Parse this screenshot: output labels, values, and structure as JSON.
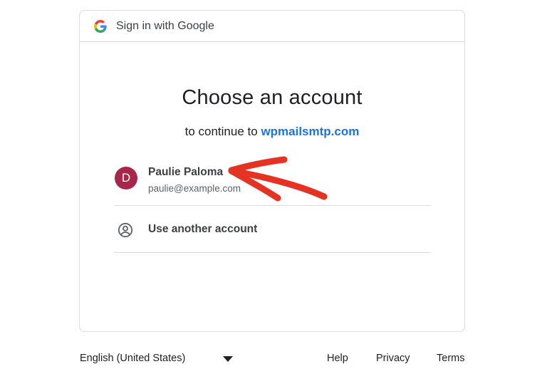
{
  "header": {
    "title": "Sign in with Google",
    "logo_icon": "google-g-logo"
  },
  "main": {
    "title": "Choose an account",
    "subtitle_prefix": "to continue to",
    "site": "wpmailsmtp.com",
    "accounts": [
      {
        "initial": "D",
        "name": "Paulie Paloma",
        "email": "paulie@example.com",
        "avatar_color": "#a8264a"
      }
    ],
    "other_account": {
      "label": "Use another account",
      "icon": "person-circle-icon"
    },
    "annotation": {
      "icon": "red-arrow-annotation",
      "color": "#e53323"
    }
  },
  "footer": {
    "language": "English (United States)",
    "links": {
      "help": "Help",
      "privacy": "Privacy",
      "terms": "Terms"
    }
  },
  "colors": {
    "link": "#1a73e8",
    "border": "#dadce0",
    "text": "#202124"
  }
}
